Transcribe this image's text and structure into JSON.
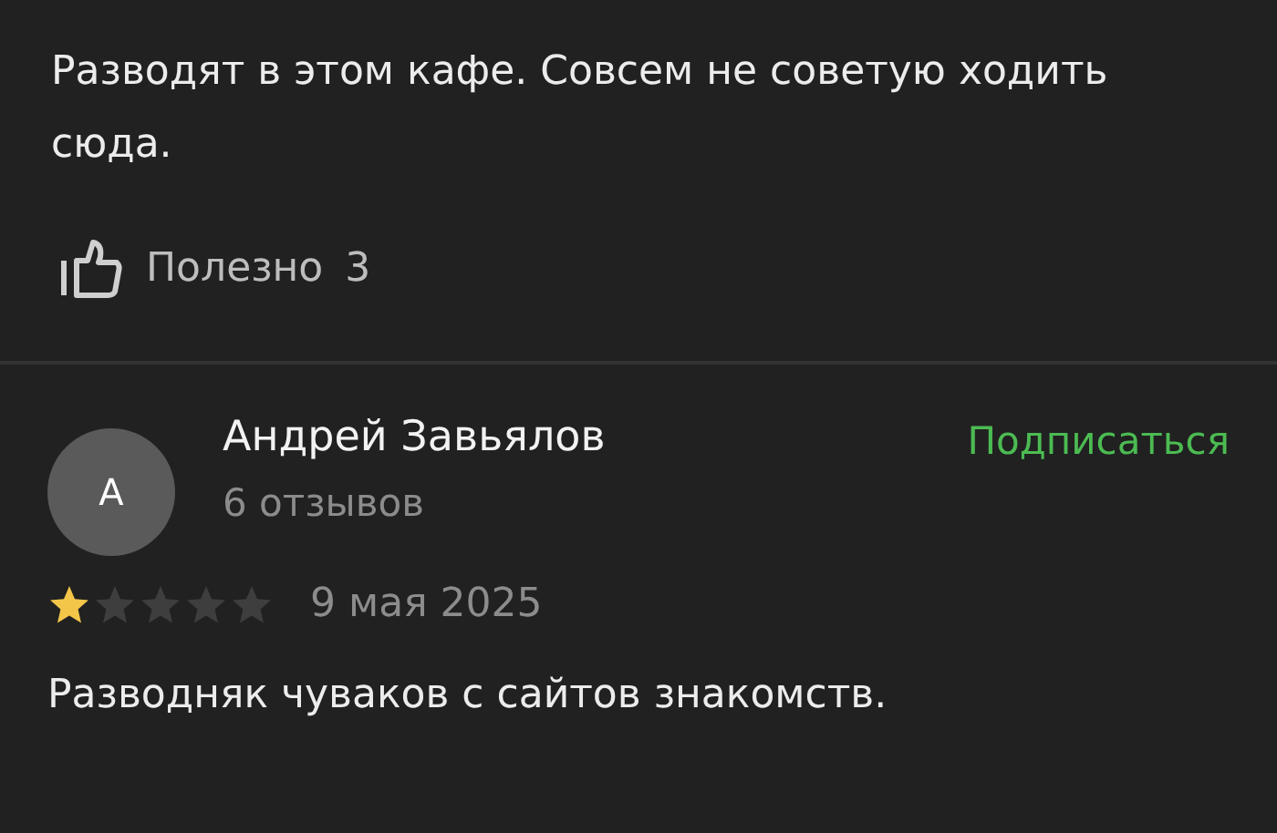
{
  "previous_review": {
    "text": "Разводят в этом кафе. Совсем не советую ходить сюда.",
    "helpful": {
      "label": "Полезно",
      "count": "3"
    }
  },
  "review": {
    "avatar_letter": "А",
    "author": "Андрей Завьялов",
    "reviews_count": "6 отзывов",
    "subscribe": "Подписаться",
    "stars": 1,
    "date": "9 мая 2025",
    "text": "Разводняк чуваков с сайтов знакомств."
  }
}
